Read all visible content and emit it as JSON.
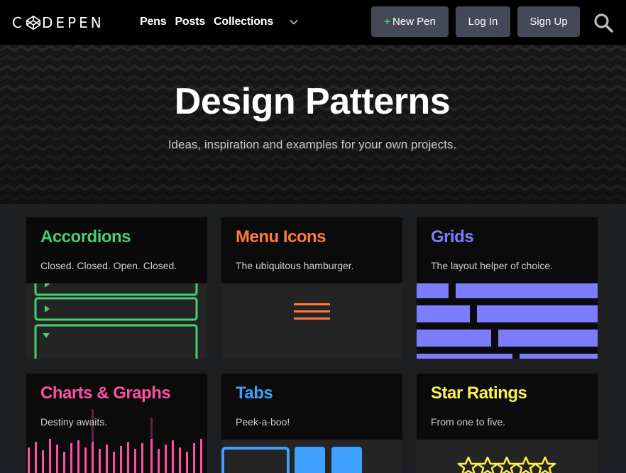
{
  "header": {
    "logo_text_left": "C",
    "logo_text_right": "DEPEN",
    "nav": [
      "Pens",
      "Posts",
      "Collections"
    ],
    "new_pen_plus": "+",
    "new_pen_label": "New Pen",
    "login_label": "Log In",
    "signup_label": "Sign Up"
  },
  "hero": {
    "title": "Design Patterns",
    "subtitle": "Ideas, inspiration and examples for your own projects."
  },
  "cards": [
    {
      "title": "Accordions",
      "desc": "Closed. Closed. Open. Closed.",
      "color": "#47cf73"
    },
    {
      "title": "Menu Icons",
      "desc": "The ubiquitous hamburger.",
      "color": "#ff7a3d"
    },
    {
      "title": "Grids",
      "desc": "The layout helper of choice.",
      "color": "#7c7cff"
    },
    {
      "title": "Charts & Graphs",
      "desc": "Destiny awaits.",
      "color": "#ff4fa3"
    },
    {
      "title": "Tabs",
      "desc": "Peek-a-boo!",
      "color": "#3fa0ff"
    },
    {
      "title": "Star Ratings",
      "desc": "From one to five.",
      "color": "#fff04d"
    }
  ],
  "icons": {
    "logo": "codepen-logo-icon",
    "dropdown": "chevron-down-icon",
    "search": "search-icon",
    "hamburger": "hamburger-icon",
    "star": "star-icon"
  }
}
